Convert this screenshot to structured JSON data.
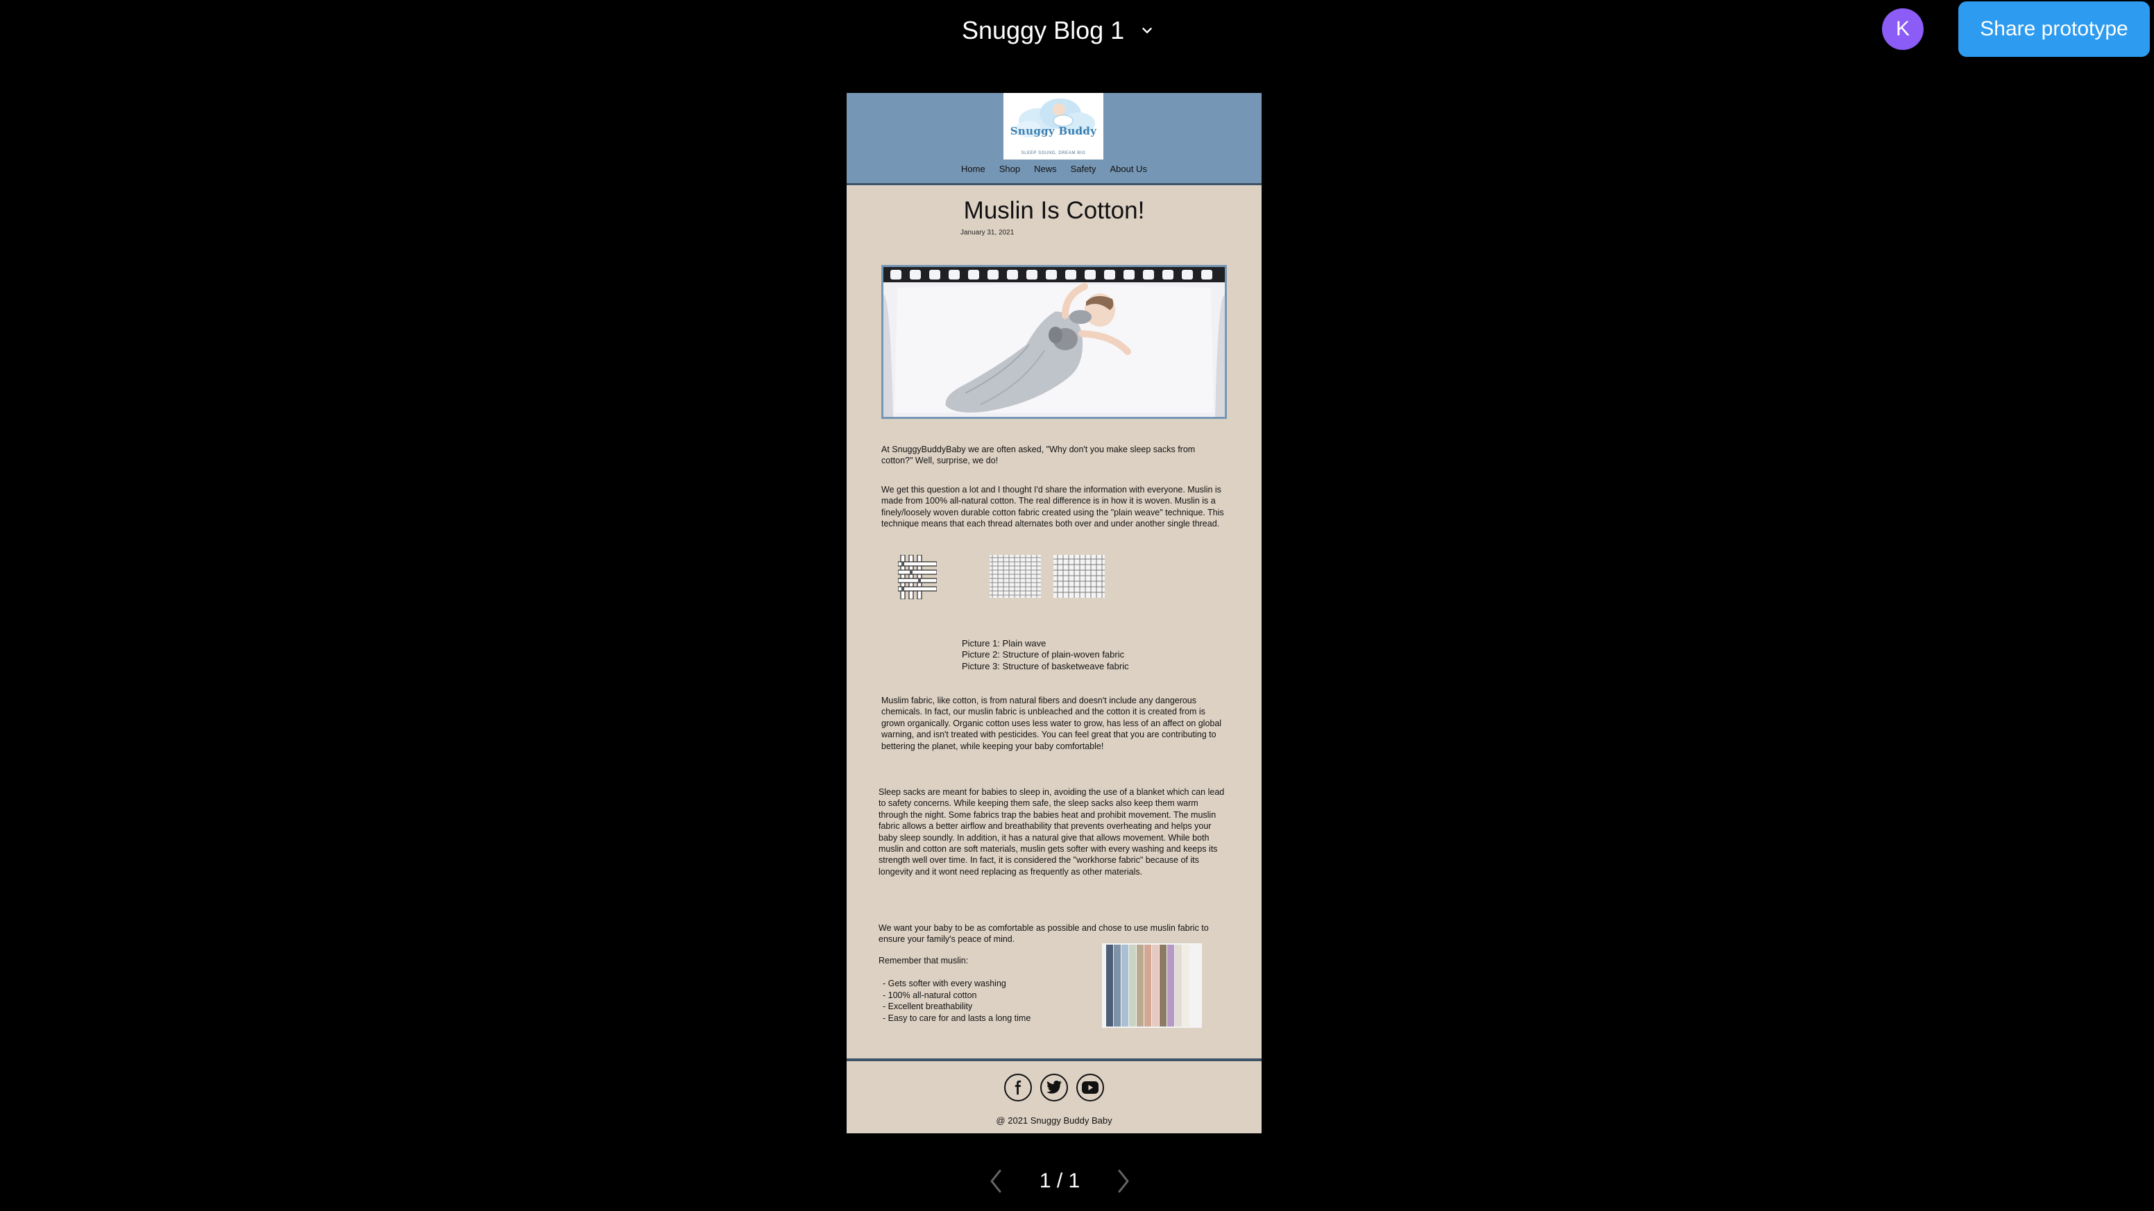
{
  "viewer": {
    "doc_title": "Snuggy Blog 1",
    "avatar_initial": "K",
    "share_label": "Share prototype",
    "page_indicator": "1 / 1"
  },
  "blog": {
    "logo_brand": "Snuggy Buddy",
    "logo_tagline": "SLEEP SOUND, DREAM BIG",
    "nav": [
      "Home",
      "Shop",
      "News",
      "Safety",
      "About Us"
    ],
    "title": "Muslin Is Cotton!",
    "date": "January 31, 2021",
    "paragraphs": [
      "At SnuggyBuddyBaby we are often asked, \"Why don't you make sleep sacks from cotton?\" Well, surprise, we do!",
      "We get this question a lot and I thought I'd share the information with everyone. Muslin is made from 100% all-natural cotton. The real difference is in how it is woven. Muslin is a finely/loosely woven durable cotton fabric created using the \"plain weave\" technique. This technique means that each thread alternates both over and under another single thread.",
      "Muslim fabric, like cotton, is from natural fibers and doesn't include any dangerous chemicals. In fact, our muslin fabric is unbleached and the cotton it is created from is grown organically. Organic cotton uses less water to grow, has less of an affect on global warning, and isn't treated with pesticides. You can feel great that you are contributing to bettering the planet, while keeping your baby comfortable!",
      "Sleep sacks are meant for babies to sleep in, avoiding the use of a blanket which can lead to safety concerns. While keeping them safe, the sleep sacks also keep them warm through the night. Some fabrics trap the babies heat and prohibit movement. The muslin fabric allows a better airflow and breathability that prevents overheating and helps your baby sleep soundly. In addition, it has a natural give that allows movement. While both muslin and cotton are soft materials, muslin gets softer with every washing and keeps its strength well over time. In fact, it is considered the \"workhorse fabric\" because of its longevity and it wont need replacing as frequently as other materials.",
      "We want your baby to be as comfortable as possible and chose to use muslin fabric to ensure your family's peace of mind."
    ],
    "captions": [
      "Picture 1: Plain wave",
      "Picture 2: Structure of plain-woven fabric",
      "Picture 3: Structure of basketweave fabric"
    ],
    "remember_label": "Remember that muslin:",
    "bullets": [
      "-  Gets softer with every washing",
      "-  100% all-natural cotton",
      "-  Excellent breathability",
      "-  Easy to care for and lasts a long time"
    ],
    "socials": [
      "facebook-icon",
      "twitter-icon",
      "youtube-icon"
    ],
    "copyright": "@ 2021 Snuggy Buddy Baby",
    "colors": {
      "header_bg": "#7596b4",
      "page_bg": "#ddd1c3",
      "accent_dark": "#3c5368",
      "share_button": "#2d9bf0",
      "avatar": "#8b5cf6"
    }
  }
}
